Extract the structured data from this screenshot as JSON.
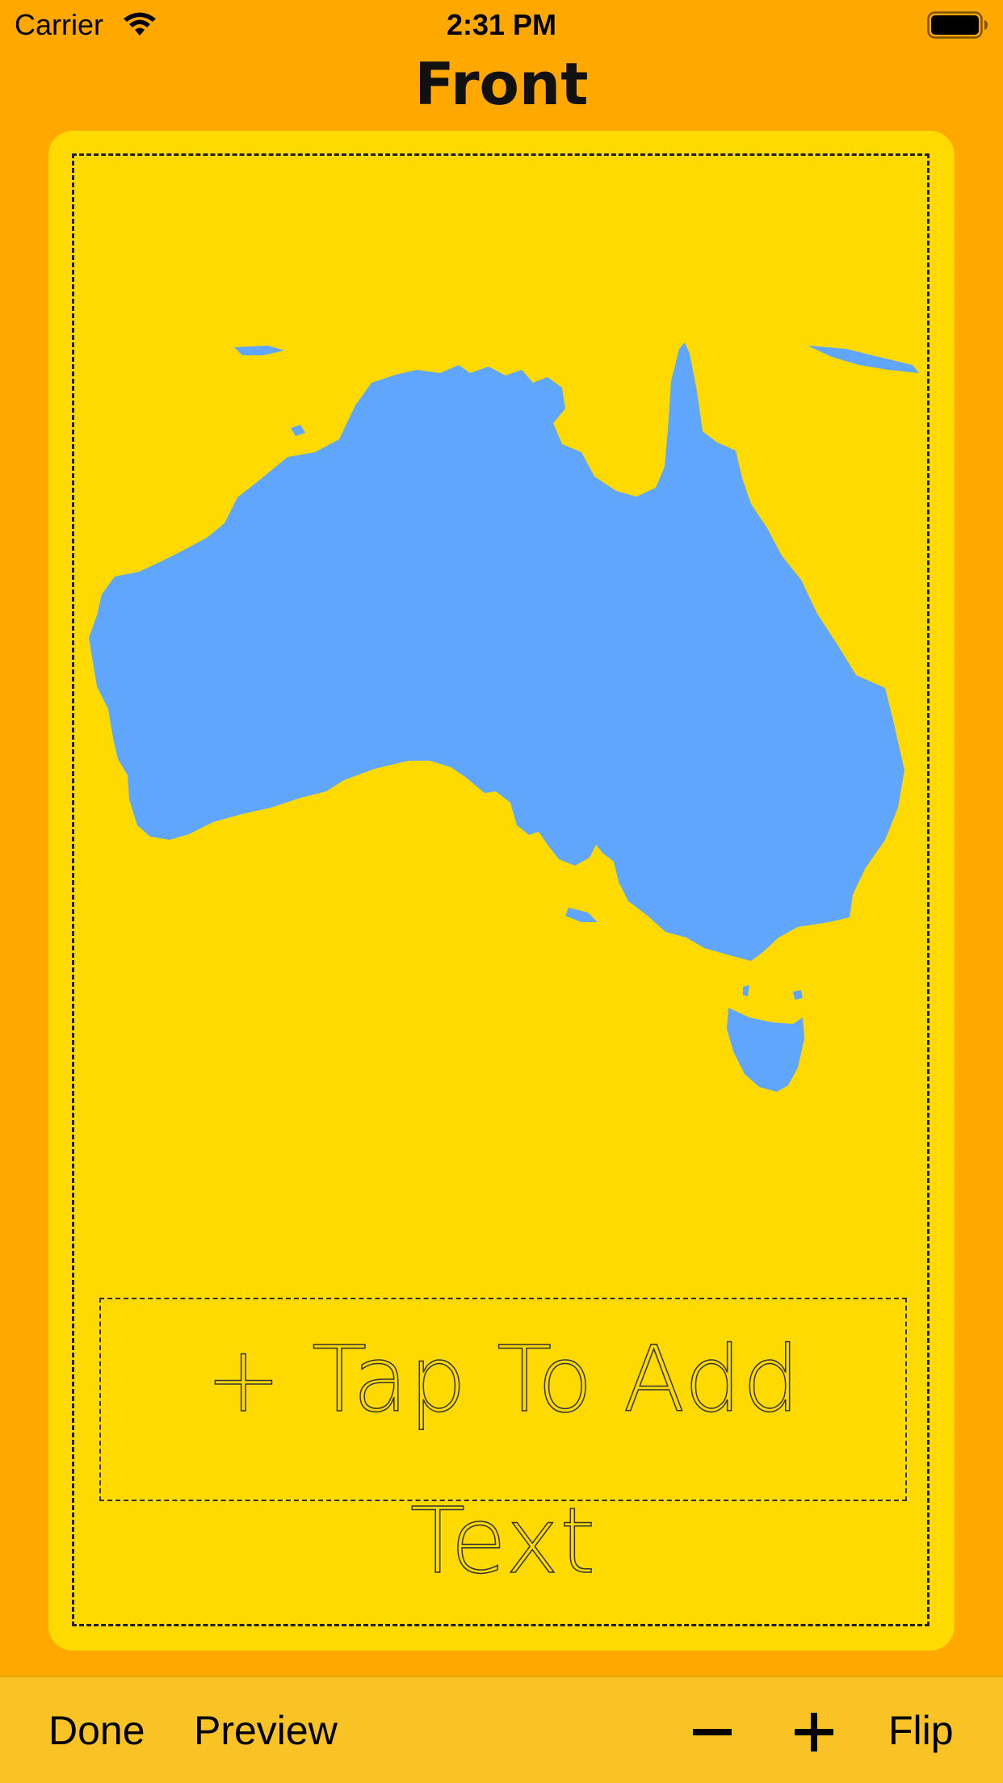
{
  "status_bar": {
    "carrier": "Carrier",
    "time": "2:31 PM"
  },
  "header": {
    "title": "Front"
  },
  "card": {
    "background_color": "#FFDA00",
    "map_color": "#5FA6FC",
    "map_icon": "australia-map",
    "text_placeholder": "+ Tap To Add Text"
  },
  "toolbar": {
    "done_label": "Done",
    "preview_label": "Preview",
    "decrease_icon": "minus-icon",
    "increase_icon": "plus-icon",
    "flip_label": "Flip"
  },
  "colors": {
    "background": "#FFA800",
    "toolbar": "#F9C326"
  }
}
